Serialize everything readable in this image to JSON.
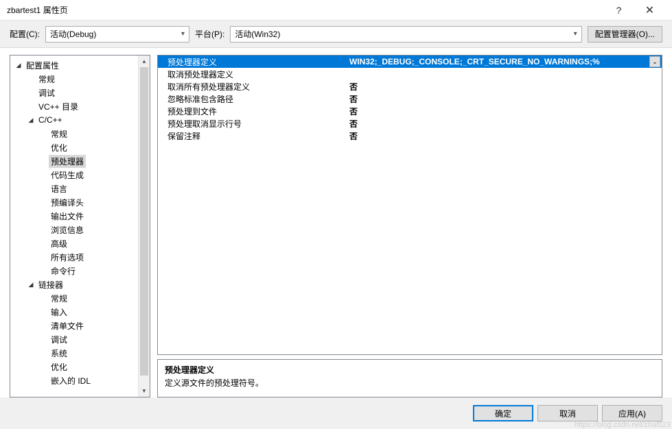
{
  "titlebar": {
    "title": "zbartest1 属性页",
    "help": "?",
    "close": "✕"
  },
  "toolbar": {
    "config_label": "配置(C):",
    "config_value": "活动(Debug)",
    "platform_label": "平台(P):",
    "platform_value": "活动(Win32)",
    "manager_label": "配置管理器(O)..."
  },
  "tree": {
    "root": {
      "label": "配置属性",
      "expanded": true
    },
    "items_lvl1": [
      {
        "label": "常规"
      },
      {
        "label": "调试"
      },
      {
        "label": "VC++ 目录"
      }
    ],
    "cpp": {
      "label": "C/C++",
      "expanded": true
    },
    "cpp_children": [
      {
        "label": "常规"
      },
      {
        "label": "优化"
      },
      {
        "label": "预处理器",
        "selected": true
      },
      {
        "label": "代码生成"
      },
      {
        "label": "语言"
      },
      {
        "label": "预编译头"
      },
      {
        "label": "输出文件"
      },
      {
        "label": "浏览信息"
      },
      {
        "label": "高级"
      },
      {
        "label": "所有选项"
      },
      {
        "label": "命令行"
      }
    ],
    "linker": {
      "label": "链接器",
      "expanded": true
    },
    "linker_children": [
      {
        "label": "常规"
      },
      {
        "label": "输入"
      },
      {
        "label": "清单文件"
      },
      {
        "label": "调试"
      },
      {
        "label": "系统"
      },
      {
        "label": "优化"
      },
      {
        "label": "嵌入的 IDL"
      }
    ]
  },
  "grid": {
    "rows": [
      {
        "name": "预处理器定义",
        "value": "WIN32;_DEBUG;_CONSOLE;_CRT_SECURE_NO_WARNINGS;%",
        "selected": true,
        "dropdown": true
      },
      {
        "name": "取消预处理器定义",
        "value": ""
      },
      {
        "name": "取消所有预处理器定义",
        "value": "否"
      },
      {
        "name": "忽略标准包含路径",
        "value": "否"
      },
      {
        "name": "预处理到文件",
        "value": "否"
      },
      {
        "name": "预处理取消显示行号",
        "value": "否"
      },
      {
        "name": "保留注释",
        "value": "否"
      }
    ]
  },
  "desc": {
    "header": "预处理器定义",
    "body": "定义源文件的预处理符号。"
  },
  "footer": {
    "ok": "确定",
    "cancel": "取消",
    "apply": "应用(A)"
  },
  "watermark": "https://blog.csdn.net/zhal523"
}
